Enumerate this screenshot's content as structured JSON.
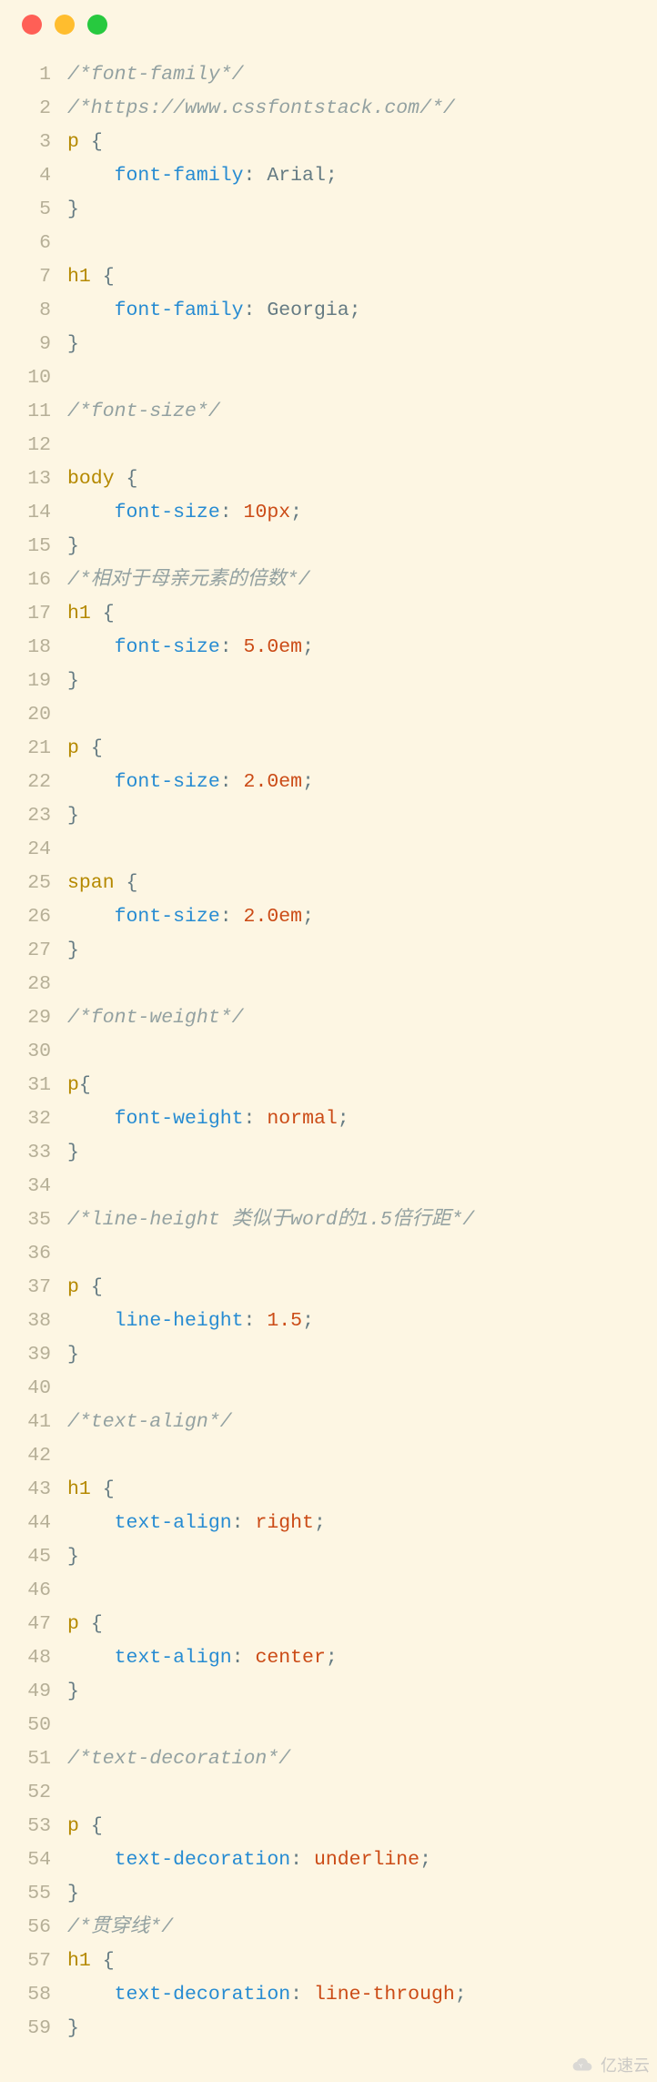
{
  "window": {
    "dots": [
      "red",
      "yellow",
      "green"
    ]
  },
  "watermark": {
    "text": "亿速云"
  },
  "code": {
    "lines": [
      {
        "n": 1,
        "t": [
          {
            "c": "comment",
            "s": "/*font-family*/"
          }
        ]
      },
      {
        "n": 2,
        "t": [
          {
            "c": "comment",
            "s": "/*https://www.cssfontstack.com/*/"
          }
        ]
      },
      {
        "n": 3,
        "t": [
          {
            "c": "selector",
            "s": "p"
          },
          {
            "c": "plain",
            "s": " "
          },
          {
            "c": "brace",
            "s": "{"
          }
        ]
      },
      {
        "n": 4,
        "t": [
          {
            "c": "plain",
            "s": "    "
          },
          {
            "c": "prop",
            "s": "font-family"
          },
          {
            "c": "punct",
            "s": ":"
          },
          {
            "c": "plain",
            "s": " Arial"
          },
          {
            "c": "punct",
            "s": ";"
          }
        ]
      },
      {
        "n": 5,
        "t": [
          {
            "c": "brace",
            "s": "}"
          }
        ]
      },
      {
        "n": 6,
        "t": [
          {
            "c": "plain",
            "s": ""
          }
        ]
      },
      {
        "n": 7,
        "t": [
          {
            "c": "selector",
            "s": "h1"
          },
          {
            "c": "plain",
            "s": " "
          },
          {
            "c": "brace",
            "s": "{"
          }
        ]
      },
      {
        "n": 8,
        "t": [
          {
            "c": "plain",
            "s": "    "
          },
          {
            "c": "prop",
            "s": "font-family"
          },
          {
            "c": "punct",
            "s": ":"
          },
          {
            "c": "plain",
            "s": " Georgia"
          },
          {
            "c": "punct",
            "s": ";"
          }
        ]
      },
      {
        "n": 9,
        "t": [
          {
            "c": "brace",
            "s": "}"
          }
        ]
      },
      {
        "n": 10,
        "t": [
          {
            "c": "plain",
            "s": ""
          }
        ]
      },
      {
        "n": 11,
        "t": [
          {
            "c": "comment",
            "s": "/*font-size*/"
          }
        ]
      },
      {
        "n": 12,
        "t": [
          {
            "c": "plain",
            "s": ""
          }
        ]
      },
      {
        "n": 13,
        "t": [
          {
            "c": "selector",
            "s": "body"
          },
          {
            "c": "plain",
            "s": " "
          },
          {
            "c": "brace",
            "s": "{"
          }
        ]
      },
      {
        "n": 14,
        "t": [
          {
            "c": "plain",
            "s": "    "
          },
          {
            "c": "prop",
            "s": "font-size"
          },
          {
            "c": "punct",
            "s": ":"
          },
          {
            "c": "plain",
            "s": " "
          },
          {
            "c": "value",
            "s": "10px"
          },
          {
            "c": "punct",
            "s": ";"
          }
        ]
      },
      {
        "n": 15,
        "t": [
          {
            "c": "brace",
            "s": "}"
          }
        ]
      },
      {
        "n": 16,
        "t": [
          {
            "c": "comment",
            "s": "/*相对于母亲元素的倍数*/"
          }
        ]
      },
      {
        "n": 17,
        "t": [
          {
            "c": "selector",
            "s": "h1"
          },
          {
            "c": "plain",
            "s": " "
          },
          {
            "c": "brace",
            "s": "{"
          }
        ]
      },
      {
        "n": 18,
        "t": [
          {
            "c": "plain",
            "s": "    "
          },
          {
            "c": "prop",
            "s": "font-size"
          },
          {
            "c": "punct",
            "s": ":"
          },
          {
            "c": "plain",
            "s": " "
          },
          {
            "c": "value",
            "s": "5.0em"
          },
          {
            "c": "punct",
            "s": ";"
          }
        ]
      },
      {
        "n": 19,
        "t": [
          {
            "c": "brace",
            "s": "}"
          }
        ]
      },
      {
        "n": 20,
        "t": [
          {
            "c": "plain",
            "s": ""
          }
        ]
      },
      {
        "n": 21,
        "t": [
          {
            "c": "selector",
            "s": "p"
          },
          {
            "c": "plain",
            "s": " "
          },
          {
            "c": "brace",
            "s": "{"
          }
        ]
      },
      {
        "n": 22,
        "t": [
          {
            "c": "plain",
            "s": "    "
          },
          {
            "c": "prop",
            "s": "font-size"
          },
          {
            "c": "punct",
            "s": ":"
          },
          {
            "c": "plain",
            "s": " "
          },
          {
            "c": "value",
            "s": "2.0em"
          },
          {
            "c": "punct",
            "s": ";"
          }
        ]
      },
      {
        "n": 23,
        "t": [
          {
            "c": "brace",
            "s": "}"
          }
        ]
      },
      {
        "n": 24,
        "t": [
          {
            "c": "plain",
            "s": ""
          }
        ]
      },
      {
        "n": 25,
        "t": [
          {
            "c": "selector",
            "s": "span"
          },
          {
            "c": "plain",
            "s": " "
          },
          {
            "c": "brace",
            "s": "{"
          }
        ]
      },
      {
        "n": 26,
        "t": [
          {
            "c": "plain",
            "s": "    "
          },
          {
            "c": "prop",
            "s": "font-size"
          },
          {
            "c": "punct",
            "s": ":"
          },
          {
            "c": "plain",
            "s": " "
          },
          {
            "c": "value",
            "s": "2.0em"
          },
          {
            "c": "punct",
            "s": ";"
          }
        ]
      },
      {
        "n": 27,
        "t": [
          {
            "c": "brace",
            "s": "}"
          }
        ]
      },
      {
        "n": 28,
        "t": [
          {
            "c": "plain",
            "s": ""
          }
        ]
      },
      {
        "n": 29,
        "t": [
          {
            "c": "comment",
            "s": "/*font-weight*/"
          }
        ]
      },
      {
        "n": 30,
        "t": [
          {
            "c": "plain",
            "s": ""
          }
        ]
      },
      {
        "n": 31,
        "t": [
          {
            "c": "selector",
            "s": "p"
          },
          {
            "c": "brace",
            "s": "{"
          }
        ]
      },
      {
        "n": 32,
        "t": [
          {
            "c": "plain",
            "s": "    "
          },
          {
            "c": "prop",
            "s": "font-weight"
          },
          {
            "c": "punct",
            "s": ":"
          },
          {
            "c": "plain",
            "s": " "
          },
          {
            "c": "value",
            "s": "normal"
          },
          {
            "c": "punct",
            "s": ";"
          }
        ]
      },
      {
        "n": 33,
        "t": [
          {
            "c": "brace",
            "s": "}"
          }
        ]
      },
      {
        "n": 34,
        "t": [
          {
            "c": "plain",
            "s": ""
          }
        ]
      },
      {
        "n": 35,
        "t": [
          {
            "c": "comment",
            "s": "/*line-height 类似于word的1.5倍行距*/"
          }
        ]
      },
      {
        "n": 36,
        "t": [
          {
            "c": "plain",
            "s": ""
          }
        ]
      },
      {
        "n": 37,
        "t": [
          {
            "c": "selector",
            "s": "p"
          },
          {
            "c": "plain",
            "s": " "
          },
          {
            "c": "brace",
            "s": "{"
          }
        ]
      },
      {
        "n": 38,
        "t": [
          {
            "c": "plain",
            "s": "    "
          },
          {
            "c": "prop",
            "s": "line-height"
          },
          {
            "c": "punct",
            "s": ":"
          },
          {
            "c": "plain",
            "s": " "
          },
          {
            "c": "value",
            "s": "1.5"
          },
          {
            "c": "punct",
            "s": ";"
          }
        ]
      },
      {
        "n": 39,
        "t": [
          {
            "c": "brace",
            "s": "}"
          }
        ]
      },
      {
        "n": 40,
        "t": [
          {
            "c": "plain",
            "s": ""
          }
        ]
      },
      {
        "n": 41,
        "t": [
          {
            "c": "comment",
            "s": "/*text-align*/"
          }
        ]
      },
      {
        "n": 42,
        "t": [
          {
            "c": "plain",
            "s": ""
          }
        ]
      },
      {
        "n": 43,
        "t": [
          {
            "c": "selector",
            "s": "h1"
          },
          {
            "c": "plain",
            "s": " "
          },
          {
            "c": "brace",
            "s": "{"
          }
        ]
      },
      {
        "n": 44,
        "t": [
          {
            "c": "plain",
            "s": "    "
          },
          {
            "c": "prop",
            "s": "text-align"
          },
          {
            "c": "punct",
            "s": ":"
          },
          {
            "c": "plain",
            "s": " "
          },
          {
            "c": "value",
            "s": "right"
          },
          {
            "c": "punct",
            "s": ";"
          }
        ]
      },
      {
        "n": 45,
        "t": [
          {
            "c": "brace",
            "s": "}"
          }
        ]
      },
      {
        "n": 46,
        "t": [
          {
            "c": "plain",
            "s": ""
          }
        ]
      },
      {
        "n": 47,
        "t": [
          {
            "c": "selector",
            "s": "p"
          },
          {
            "c": "plain",
            "s": " "
          },
          {
            "c": "brace",
            "s": "{"
          }
        ]
      },
      {
        "n": 48,
        "t": [
          {
            "c": "plain",
            "s": "    "
          },
          {
            "c": "prop",
            "s": "text-align"
          },
          {
            "c": "punct",
            "s": ":"
          },
          {
            "c": "plain",
            "s": " "
          },
          {
            "c": "value",
            "s": "center"
          },
          {
            "c": "punct",
            "s": ";"
          }
        ]
      },
      {
        "n": 49,
        "t": [
          {
            "c": "brace",
            "s": "}"
          }
        ]
      },
      {
        "n": 50,
        "t": [
          {
            "c": "plain",
            "s": ""
          }
        ]
      },
      {
        "n": 51,
        "t": [
          {
            "c": "comment",
            "s": "/*text-decoration*/"
          }
        ]
      },
      {
        "n": 52,
        "t": [
          {
            "c": "plain",
            "s": ""
          }
        ]
      },
      {
        "n": 53,
        "t": [
          {
            "c": "selector",
            "s": "p"
          },
          {
            "c": "plain",
            "s": " "
          },
          {
            "c": "brace",
            "s": "{"
          }
        ]
      },
      {
        "n": 54,
        "t": [
          {
            "c": "plain",
            "s": "    "
          },
          {
            "c": "prop",
            "s": "text-decoration"
          },
          {
            "c": "punct",
            "s": ":"
          },
          {
            "c": "plain",
            "s": " "
          },
          {
            "c": "value",
            "s": "underline"
          },
          {
            "c": "punct",
            "s": ";"
          }
        ]
      },
      {
        "n": 55,
        "t": [
          {
            "c": "brace",
            "s": "}"
          }
        ]
      },
      {
        "n": 56,
        "t": [
          {
            "c": "comment",
            "s": "/*贯穿线*/"
          }
        ]
      },
      {
        "n": 57,
        "t": [
          {
            "c": "selector",
            "s": "h1"
          },
          {
            "c": "plain",
            "s": " "
          },
          {
            "c": "brace",
            "s": "{"
          }
        ]
      },
      {
        "n": 58,
        "t": [
          {
            "c": "plain",
            "s": "    "
          },
          {
            "c": "prop",
            "s": "text-decoration"
          },
          {
            "c": "punct",
            "s": ":"
          },
          {
            "c": "plain",
            "s": " "
          },
          {
            "c": "value",
            "s": "line-through"
          },
          {
            "c": "punct",
            "s": ";"
          }
        ]
      },
      {
        "n": 59,
        "t": [
          {
            "c": "brace",
            "s": "}"
          }
        ]
      }
    ]
  }
}
